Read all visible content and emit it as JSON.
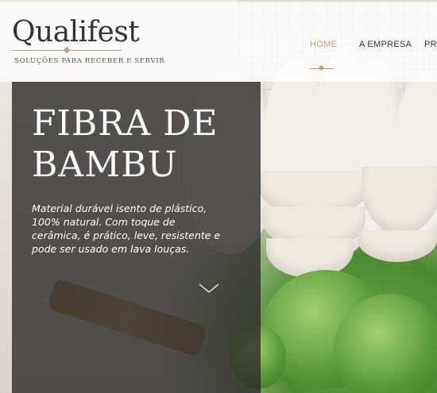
{
  "brand": {
    "name": "Qualifest",
    "tagline": "SOLUÇÕES PARA RECEBER E SERVIR",
    "accent_color": "#c49b74"
  },
  "nav": {
    "items": [
      {
        "label": "HOME",
        "active": true
      },
      {
        "label": "A EMPRESA",
        "active": false
      },
      {
        "label": "PRO",
        "active": false
      }
    ]
  },
  "hero": {
    "title_line1": "FIBRA DE",
    "title_line2": "BAMBU",
    "description": "Material durável isento de plástico, 100% natural. Com toque de cerâmica, é prático, leve, resistente e pode ser usado em lava louças.",
    "scroll_icon": "chevron-down-icon"
  }
}
